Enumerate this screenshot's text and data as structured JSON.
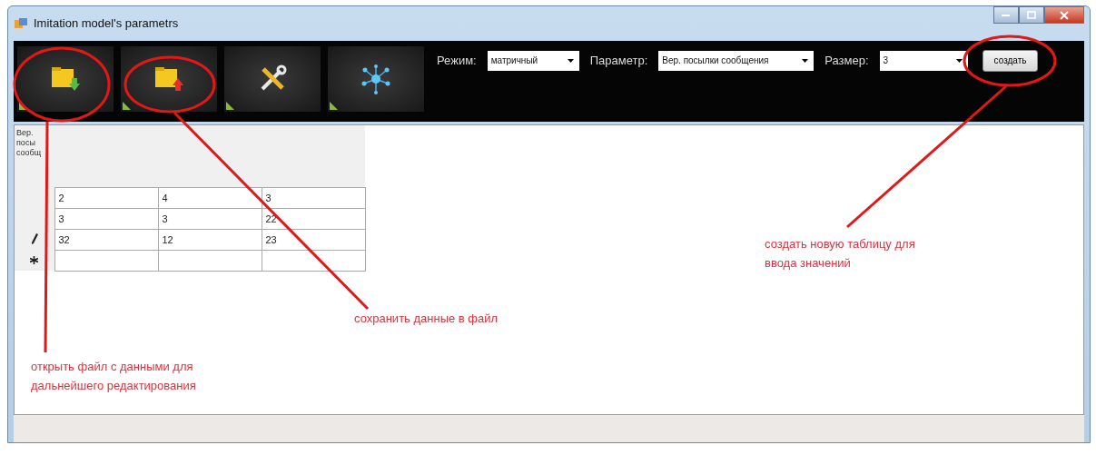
{
  "window": {
    "title": "Imitation model's parametrs"
  },
  "toolbar": {
    "buttons": [
      {
        "kind": "open"
      },
      {
        "kind": "save"
      },
      {
        "kind": "tools"
      },
      {
        "kind": "network"
      }
    ],
    "fields": [
      {
        "label": "Режим:",
        "value": "матричный"
      },
      {
        "label": "Параметр:",
        "value": "Вер. посылки сообщения"
      },
      {
        "label": "Размер:",
        "value": "3"
      }
    ],
    "create_button": "создать"
  },
  "table": {
    "corner_header": "Вер. посы сообщ",
    "rows": [
      {
        "kind": "data",
        "editing": false,
        "cells": [
          "2",
          "4",
          "3"
        ]
      },
      {
        "kind": "data",
        "editing": false,
        "cells": [
          "3",
          "3",
          "22"
        ]
      },
      {
        "kind": "data",
        "editing": true,
        "cells": [
          "32",
          "12",
          "23"
        ]
      },
      {
        "kind": "new",
        "editing": false,
        "cells": []
      }
    ]
  },
  "annotations": [
    {
      "kind": "open",
      "text": "открыть файл с данными для дальнейшего редактирования"
    },
    {
      "kind": "save",
      "text": "сохранить данные в файл"
    },
    {
      "kind": "create",
      "text": "создать новую таблицу для ввода значений"
    }
  ]
}
